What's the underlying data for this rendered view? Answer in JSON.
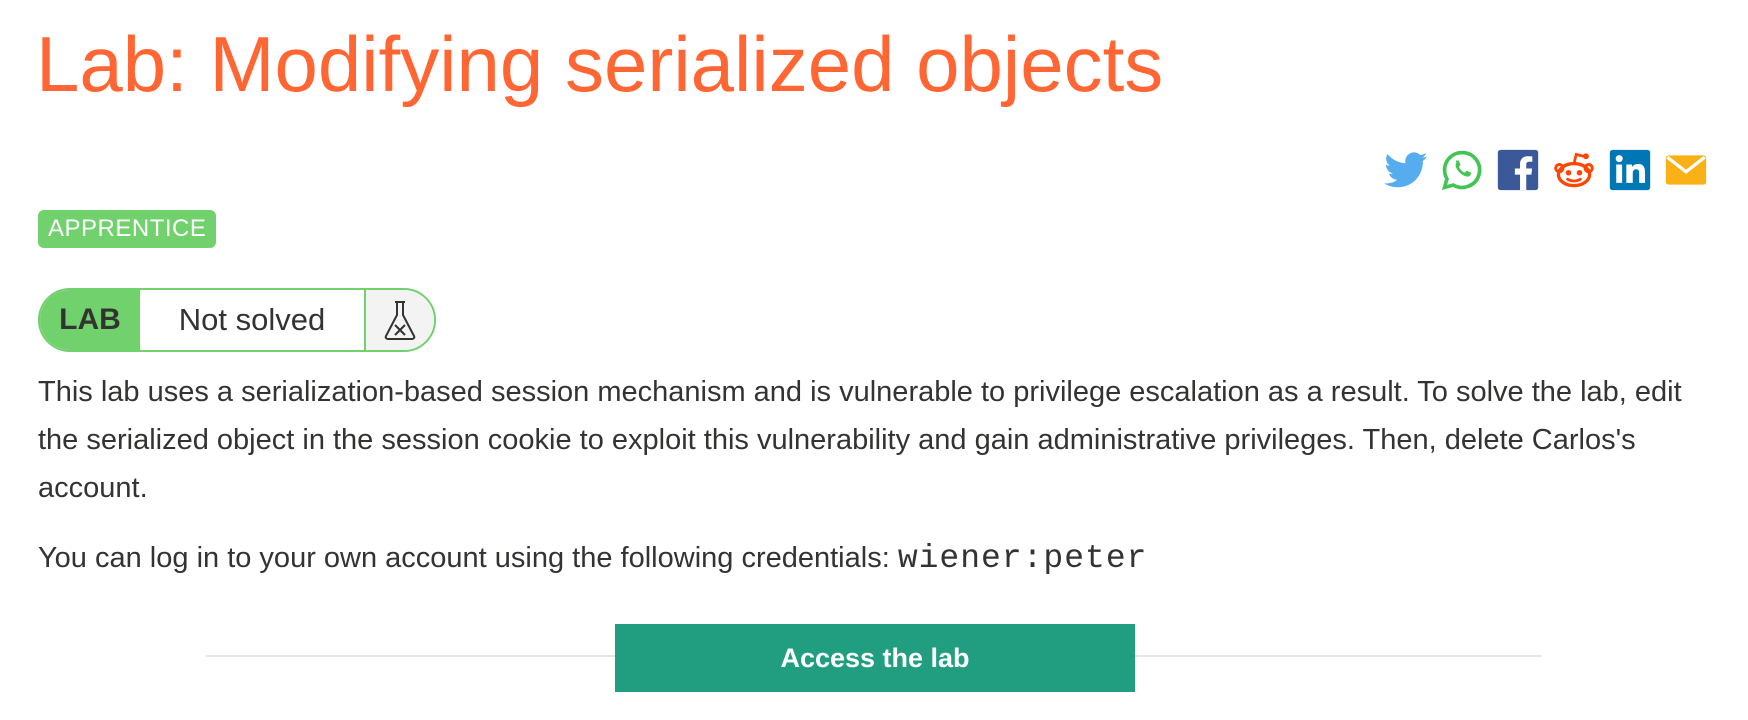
{
  "header": {
    "title": "Lab: Modifying serialized objects"
  },
  "share": {
    "icons": [
      "twitter-icon",
      "whatsapp-icon",
      "facebook-icon",
      "reddit-icon",
      "linkedin-icon",
      "email-icon"
    ],
    "colors": {
      "twitter": "#55acee",
      "whatsapp": "#43c553",
      "facebook": "#3b5998",
      "reddit": "#ff4500",
      "linkedin": "#0077b5",
      "email": "#f9b116"
    }
  },
  "level": {
    "label": "APPRENTICE",
    "color": "#70d16d"
  },
  "lab_status": {
    "tag": "LAB",
    "state": "Not solved",
    "icon": "flask-not-solved-icon"
  },
  "description": {
    "paragraph": "This lab uses a serialization-based session mechanism and is vulnerable to privilege escalation as a result. To solve the lab, edit the serialized object in the session cookie to exploit this vulnerability and gain administrative privileges. Then, delete Carlos's account.",
    "credentials_prefix": "You can log in to your own account using the following credentials: ",
    "credentials": "wiener:peter"
  },
  "actions": {
    "access_label": "Access the lab",
    "access_color": "#219e80"
  },
  "colors": {
    "title": "#ff6633",
    "text": "#333332"
  }
}
